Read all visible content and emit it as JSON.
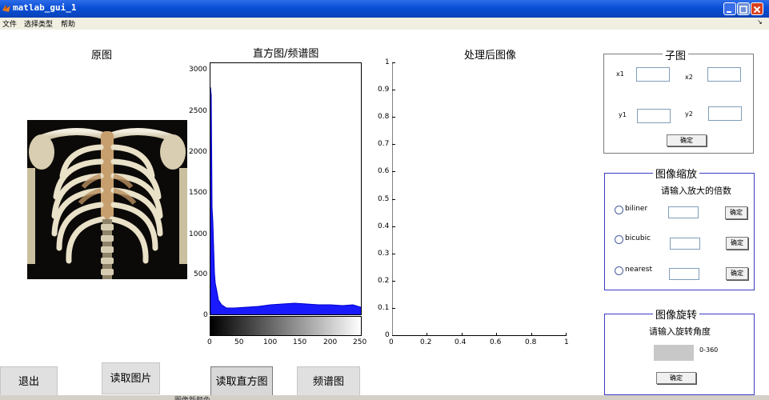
{
  "window": {
    "title": "matlab_gui_1"
  },
  "menu": [
    "文件",
    "选择类型",
    "帮助"
  ],
  "menu_arrow": "↘",
  "panels": {
    "original_title": "原图",
    "histogram_title": "直方图/频谱图",
    "processed_title": "处理后图像"
  },
  "histogram_axis": {
    "y_ticks": [
      "3000",
      "2500",
      "2000",
      "1500",
      "1000",
      "500",
      "0"
    ],
    "x_ticks": [
      "0",
      "50",
      "100",
      "150",
      "200",
      "250"
    ]
  },
  "processed_axis": {
    "y_ticks": [
      "1",
      "0.9",
      "0.8",
      "0.7",
      "0.6",
      "0.5",
      "0.4",
      "0.3",
      "0.2",
      "0.1",
      "0"
    ],
    "x_ticks": [
      "0",
      "0.2",
      "0.4",
      "0.6",
      "0.8",
      "1"
    ]
  },
  "subplot": {
    "title": "子图",
    "x1": "x1",
    "x2": "x2",
    "y1": "y1",
    "y2": "y2",
    "confirm": "确定",
    "values": {
      "x1": "",
      "x2": "",
      "y1": "",
      "y2": ""
    }
  },
  "zoom": {
    "title": "图像缩放",
    "prompt": "请输入放大的倍数",
    "options": [
      "biliner",
      "bicubic",
      "nearest"
    ],
    "confirm": "确定"
  },
  "rotate": {
    "title": "图像旋转",
    "prompt": "请输入旋转角度",
    "range": "0-360",
    "confirm": "确定"
  },
  "buttons": {
    "exit": "退出",
    "read_image": "读取图片",
    "read_histogram": "读取直方图",
    "spectrum": "频谱图"
  },
  "bottom_fragment": "图像新颜色"
}
